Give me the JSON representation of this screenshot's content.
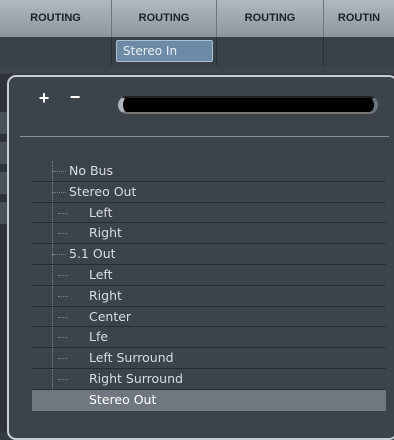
{
  "header": {
    "columns": [
      "ROUTING",
      "ROUTING",
      "ROUTING",
      "ROUTIN"
    ]
  },
  "routing_row": {
    "input_value": "Stereo In"
  },
  "popup": {
    "add_label": "+",
    "remove_label": "−",
    "search_value": "",
    "items": [
      {
        "label": "No Bus",
        "level": 1
      },
      {
        "label": "Stereo Out",
        "level": 1
      },
      {
        "label": "Left",
        "level": 2
      },
      {
        "label": "Right",
        "level": 2
      },
      {
        "label": "5.1 Out",
        "level": 1
      },
      {
        "label": "Left",
        "level": 2
      },
      {
        "label": "Right",
        "level": 2
      },
      {
        "label": "Center",
        "level": 2
      },
      {
        "label": "Lfe",
        "level": 2
      },
      {
        "label": "Left Surround",
        "level": 2
      },
      {
        "label": "Right Surround",
        "level": 2
      },
      {
        "label": "Stereo Out",
        "level": 2,
        "selected": true
      }
    ]
  },
  "colors": {
    "accent": "#6d8ba6",
    "selection": "#707780"
  }
}
